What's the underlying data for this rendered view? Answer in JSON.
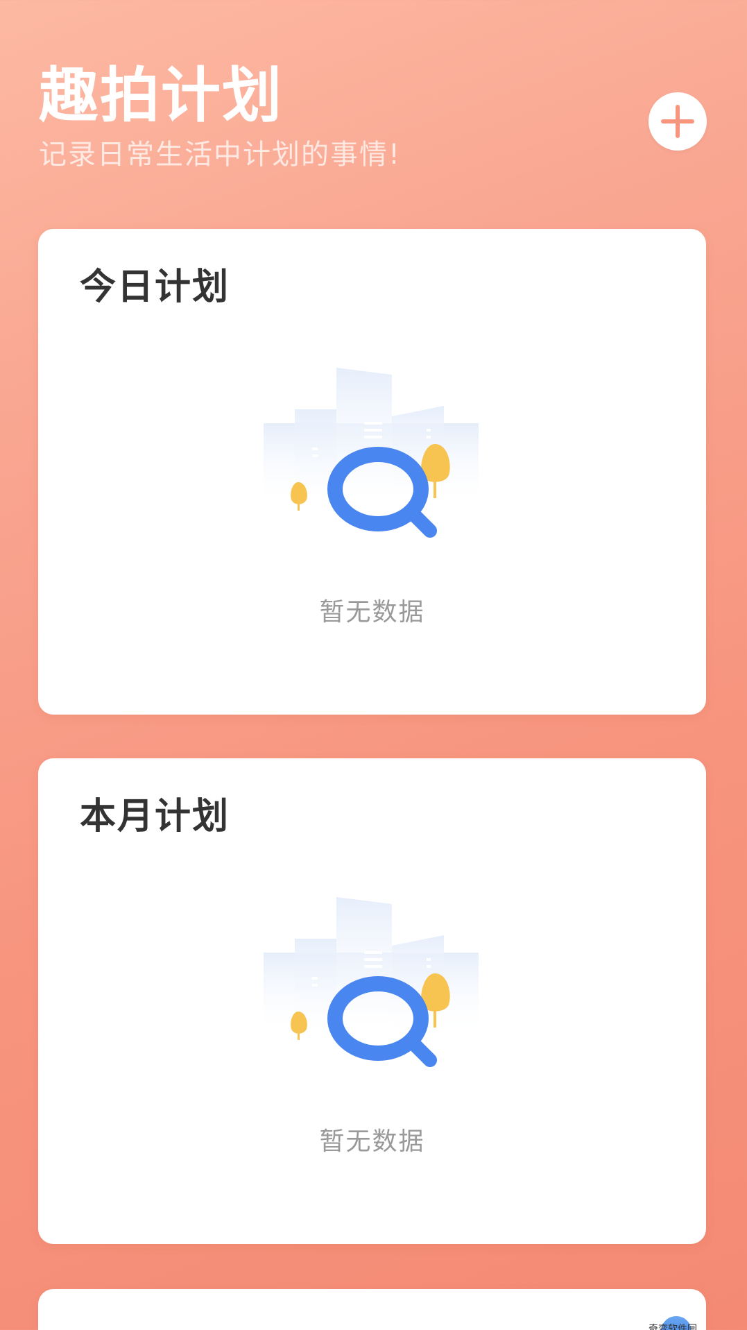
{
  "header": {
    "title": "趣拍计划",
    "subtitle": "记录日常生活中计划的事情!"
  },
  "add_button": {
    "icon": "plus-icon"
  },
  "cards": [
    {
      "title": "今日计划",
      "empty_text": "暂无数据"
    },
    {
      "title": "本月计划",
      "empty_text": "暂无数据"
    }
  ],
  "watermark": {
    "text": "奇变软件园"
  },
  "colors": {
    "background_top": "#fdb9a3",
    "background_bottom": "#f48a74",
    "plus_icon": "#f7957f",
    "magnifier": "#4a86f0",
    "tree": "#f7c351"
  }
}
